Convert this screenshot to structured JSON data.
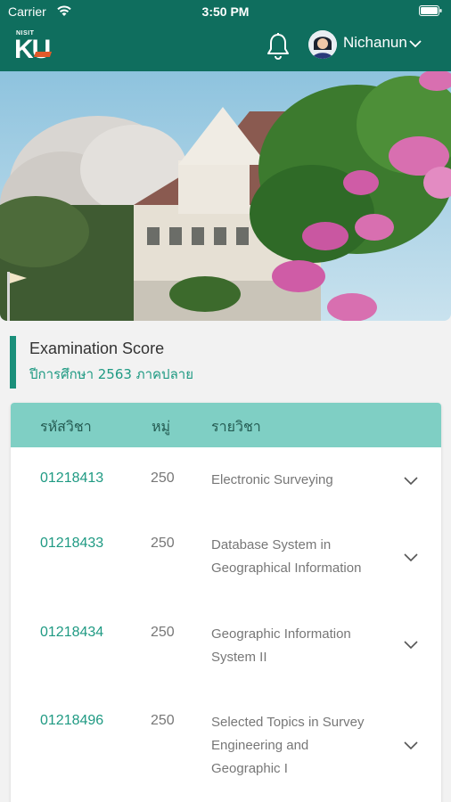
{
  "status_bar": {
    "carrier": "Carrier",
    "time": "3:50 PM"
  },
  "header": {
    "logo_small": "NISIT",
    "logo_k": "K",
    "logo_u": "U",
    "user_name": "Nichanun",
    "brand_color": "#0f6e5e"
  },
  "section": {
    "title": "Examination Score",
    "subtitle": "ปีการศึกษา 2563 ภาคปลาย"
  },
  "table": {
    "headers": {
      "code": "รหัสวิชา",
      "section": "หมู่",
      "name": "รายวิชา"
    },
    "rows": [
      {
        "code": "01218413",
        "section": "250",
        "name": "Electronic Surveying"
      },
      {
        "code": "01218433",
        "section": "250",
        "name": "Database System in Geographical Information"
      },
      {
        "code": "01218434",
        "section": "250",
        "name": "Geographic Information System II"
      },
      {
        "code": "01218496",
        "section": "250",
        "name": "Selected Topics in Survey Engineering and Geographic I"
      }
    ]
  },
  "icons": [
    "wifi-icon",
    "battery-icon",
    "bell-icon",
    "chevron-down-icon"
  ]
}
